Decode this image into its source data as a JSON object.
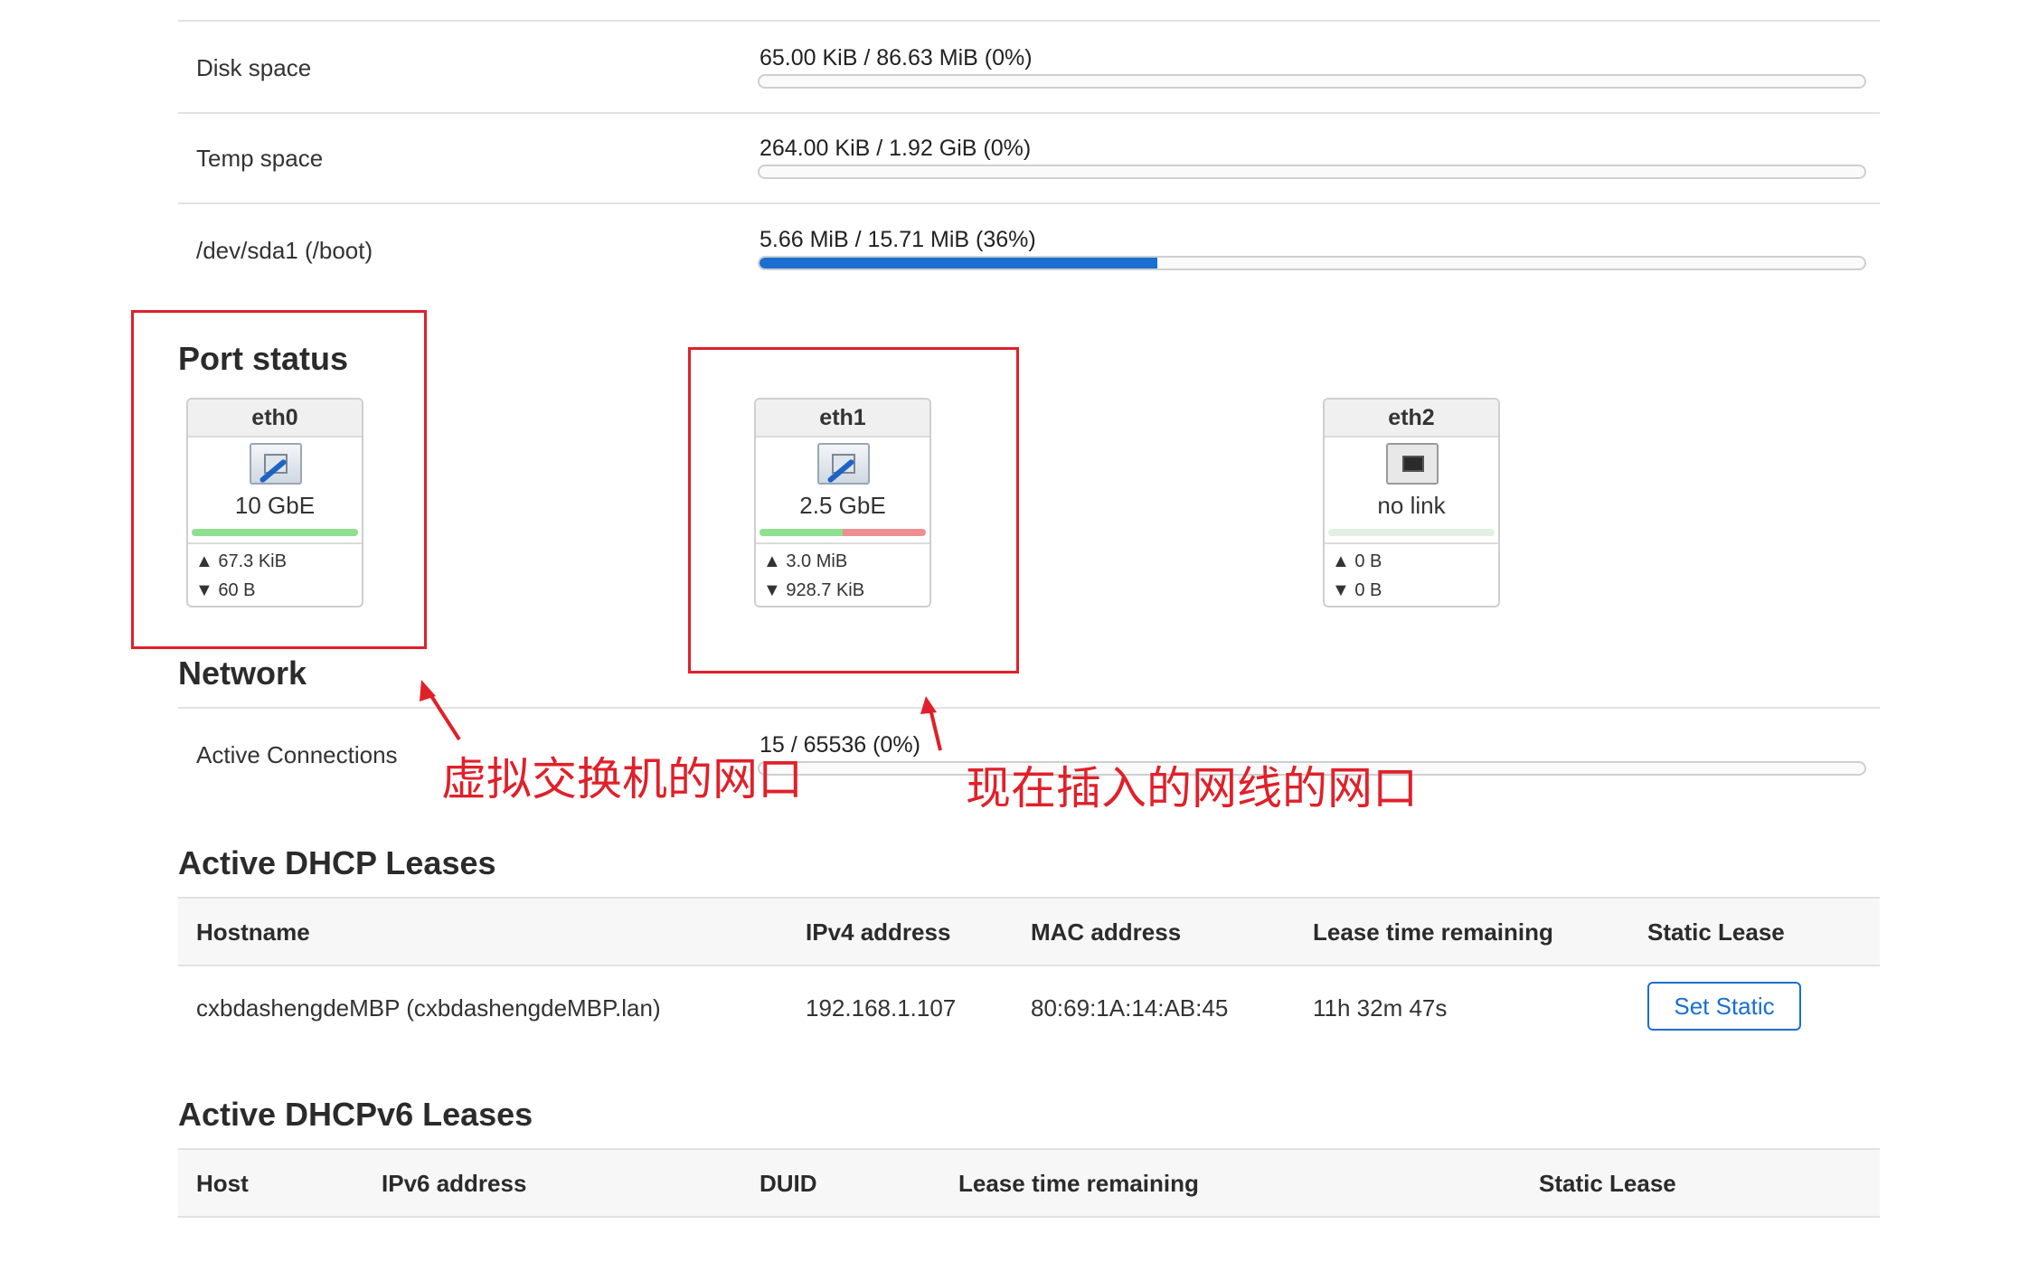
{
  "storage": {
    "rows": [
      {
        "label": "Disk space",
        "value": "65.00 KiB / 86.63 MiB (0%)",
        "percent": 0
      },
      {
        "label": "Temp space",
        "value": "264.00 KiB / 1.92 GiB (0%)",
        "percent": 0
      },
      {
        "label": "/dev/sda1 (/boot)",
        "value": "5.66 MiB / 15.71 MiB (36%)",
        "percent": 36
      }
    ]
  },
  "port_status": {
    "title": "Port status",
    "ports": [
      {
        "name": "eth0",
        "speed": "10 GbE",
        "tx": "▲ 67.3 KiB",
        "rx": "▼ 60 B",
        "link": true,
        "tx_fraction": 1.0,
        "rx_fraction": 0.0
      },
      {
        "name": "eth1",
        "speed": "2.5 GbE",
        "tx": "▲ 3.0 MiB",
        "rx": "▼ 928.7 KiB",
        "link": true,
        "tx_fraction": 0.5,
        "rx_fraction": 0.5
      },
      {
        "name": "eth2",
        "speed": "no link",
        "tx": "▲ 0 B",
        "rx": "▼ 0 B",
        "link": false,
        "tx_fraction": 0,
        "rx_fraction": 0
      }
    ]
  },
  "network": {
    "title": "Network",
    "active_connections_label": "Active Connections",
    "active_connections_value": "15 / 65536 (0%)"
  },
  "annotations": {
    "left": "虚拟交换机的网口",
    "right": "现在插入的网线的网口"
  },
  "dhcp": {
    "title": "Active DHCP Leases",
    "headers": [
      "Hostname",
      "IPv4 address",
      "MAC address",
      "Lease time remaining",
      "Static Lease"
    ],
    "rows": [
      {
        "hostname": "cxbdashengdeMBP (cxbdashengdeMBP.lan)",
        "ipv4": "192.168.1.107",
        "mac": "80:69:1A:14:AB:45",
        "lease": "11h 32m 47s",
        "button": "Set Static"
      }
    ]
  },
  "dhcpv6": {
    "title": "Active DHCPv6 Leases",
    "headers": [
      "Host",
      "IPv6 address",
      "DUID",
      "Lease time remaining",
      "Static Lease"
    ]
  },
  "colors": {
    "accent": "#1a6fd1",
    "annotation": "#e0202a",
    "tx": "#8ee08e",
    "rx": "#ef9090"
  }
}
